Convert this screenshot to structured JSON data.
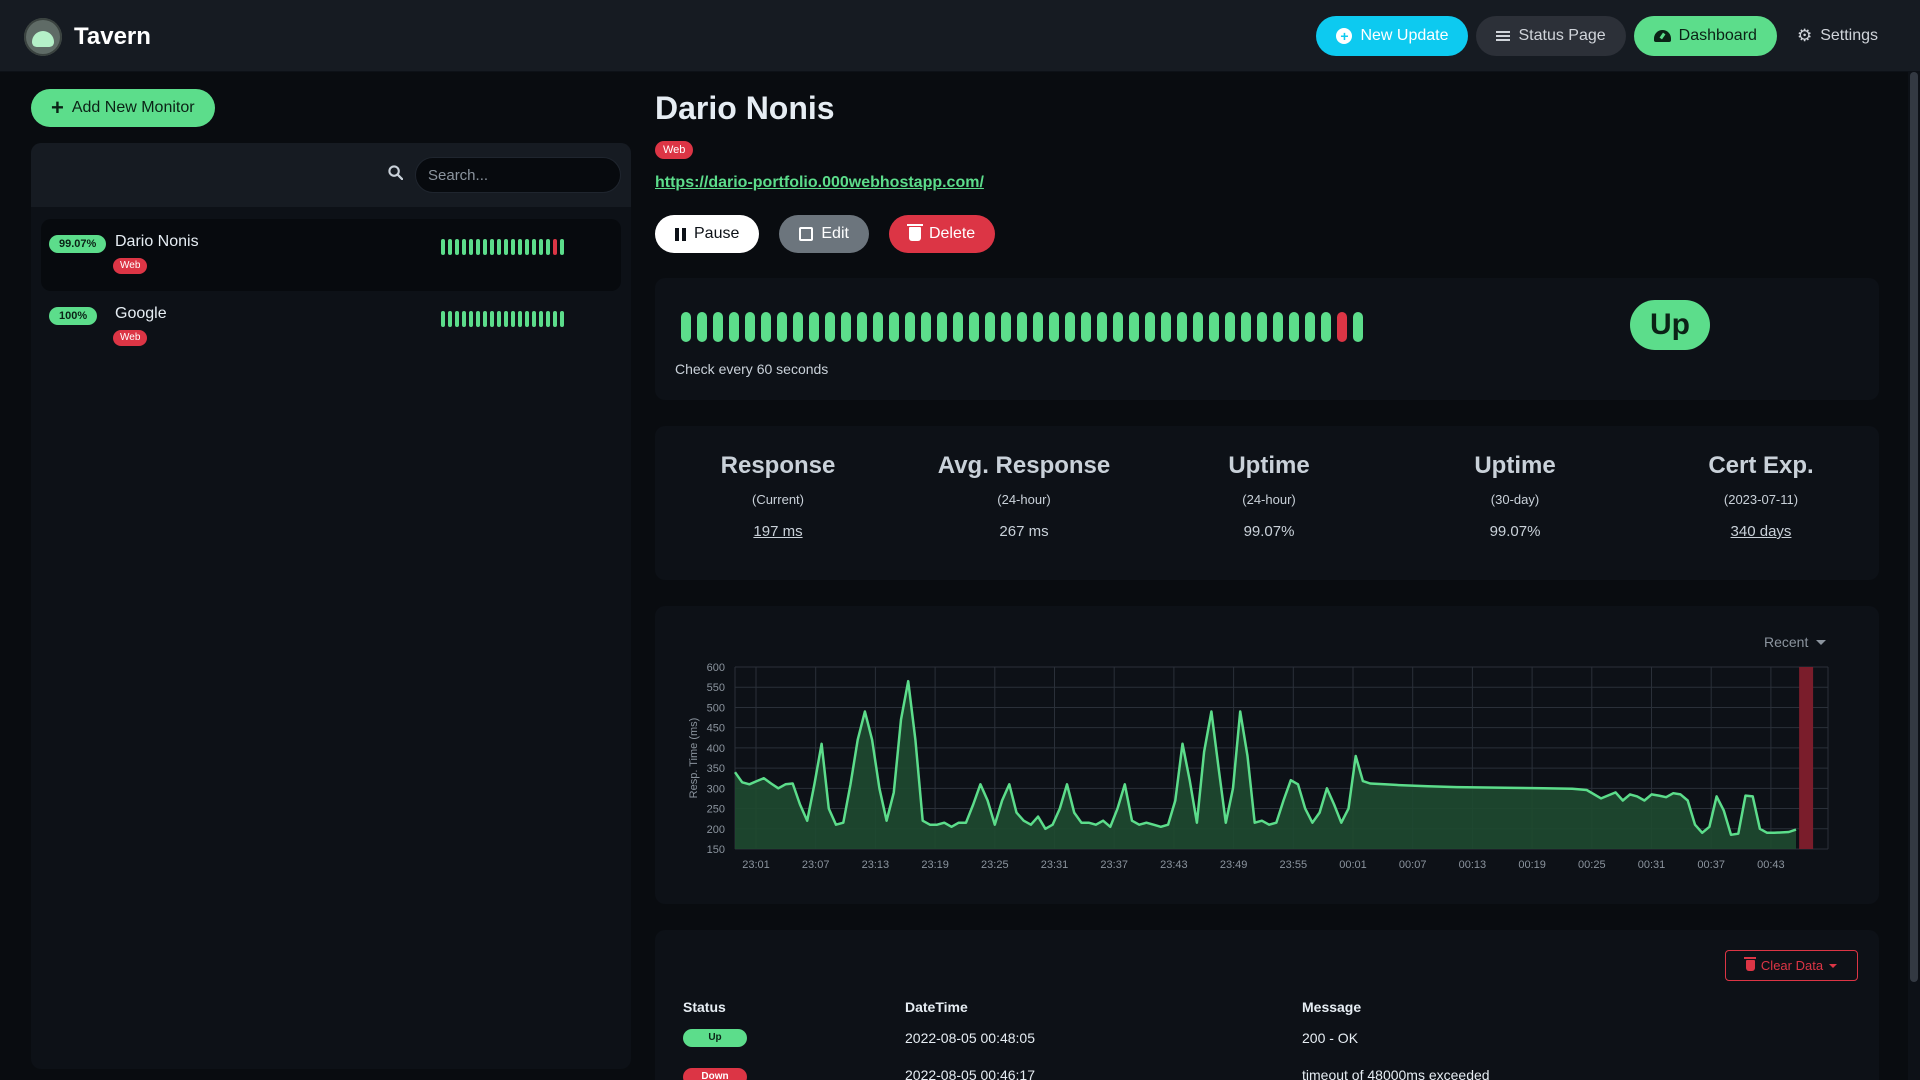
{
  "app": {
    "name": "Tavern"
  },
  "nav": {
    "new_update": "New Update",
    "status_page": "Status Page",
    "dashboard": "Dashboard",
    "settings": "Settings"
  },
  "sidebar": {
    "add_label": "Add New Monitor",
    "search_placeholder": "Search...",
    "monitors": [
      {
        "uptime": "99.07%",
        "name": "Dario Nonis",
        "tag": "Web",
        "beats": [
          1,
          1,
          1,
          1,
          1,
          1,
          1,
          1,
          1,
          1,
          1,
          1,
          1,
          1,
          1,
          1,
          0,
          1
        ]
      },
      {
        "uptime": "100%",
        "name": "Google",
        "tag": "Web",
        "beats": [
          1,
          1,
          1,
          1,
          1,
          1,
          1,
          1,
          1,
          1,
          1,
          1,
          1,
          1,
          1,
          1,
          1,
          1
        ]
      }
    ]
  },
  "detail": {
    "title": "Dario Nonis",
    "tag": "Web",
    "url": "https://dario-portfolio.000webhostapp.com/",
    "pause": "Pause",
    "edit": "Edit",
    "delete": "Delete",
    "check_every": "Check every 60 seconds",
    "status": "Up",
    "beats": [
      1,
      1,
      1,
      1,
      1,
      1,
      1,
      1,
      1,
      1,
      1,
      1,
      1,
      1,
      1,
      1,
      1,
      1,
      1,
      1,
      1,
      1,
      1,
      1,
      1,
      1,
      1,
      1,
      1,
      1,
      1,
      1,
      1,
      1,
      1,
      1,
      1,
      1,
      1,
      1,
      1,
      0,
      1
    ]
  },
  "stats": [
    {
      "heading": "Response",
      "sub": "(Current)",
      "value": "197 ms"
    },
    {
      "heading": "Avg. Response",
      "sub": "(24-hour)",
      "value": "267 ms"
    },
    {
      "heading": "Uptime",
      "sub": "(24-hour)",
      "value": "99.07%"
    },
    {
      "heading": "Uptime",
      "sub": "(30-day)",
      "value": "99.07%"
    },
    {
      "heading": "Cert Exp.",
      "sub": "(2023-07-11)",
      "value": "340 days"
    }
  ],
  "chart": {
    "range_label": "Recent",
    "colors": {
      "line": "#5cdd8b",
      "fill": "#1e4a30",
      "grid": "#2a3039",
      "down": "#7a1d2b",
      "tick": "#8b949e"
    }
  },
  "chart_data": {
    "type": "line",
    "title": "",
    "xlabel": "",
    "ylabel": "Resp. Time (ms)",
    "ylim": [
      150,
      600
    ],
    "yticks": [
      150,
      200,
      250,
      300,
      350,
      400,
      450,
      500,
      550,
      600
    ],
    "xticks": [
      "23:01",
      "23:07",
      "23:13",
      "23:19",
      "23:25",
      "23:31",
      "23:37",
      "23:43",
      "23:49",
      "23:55",
      "00:01",
      "00:07",
      "00:13",
      "00:19",
      "00:25",
      "00:31",
      "00:37",
      "00:43"
    ],
    "series": [
      {
        "values": [
          [
            0,
            340
          ],
          [
            0.5,
            315
          ],
          [
            1,
            310
          ],
          [
            1.5,
            318
          ],
          [
            2,
            325
          ],
          [
            2.5,
            312
          ],
          [
            3,
            300
          ],
          [
            3.5,
            310
          ],
          [
            4,
            312
          ],
          [
            4.5,
            260
          ],
          [
            5,
            220
          ],
          [
            5.5,
            310
          ],
          [
            6,
            410
          ],
          [
            6.5,
            250
          ],
          [
            7,
            210
          ],
          [
            7.5,
            215
          ],
          [
            8,
            310
          ],
          [
            8.5,
            420
          ],
          [
            9,
            490
          ],
          [
            9.5,
            420
          ],
          [
            10,
            300
          ],
          [
            10.5,
            220
          ],
          [
            11,
            290
          ],
          [
            11.5,
            470
          ],
          [
            12,
            565
          ],
          [
            12.5,
            420
          ],
          [
            13,
            220
          ],
          [
            13.5,
            210
          ],
          [
            14,
            210
          ],
          [
            14.5,
            215
          ],
          [
            15,
            205
          ],
          [
            15.5,
            215
          ],
          [
            16,
            215
          ],
          [
            16.5,
            260
          ],
          [
            17,
            310
          ],
          [
            17.5,
            270
          ],
          [
            18,
            210
          ],
          [
            18.5,
            270
          ],
          [
            19,
            310
          ],
          [
            19.5,
            240
          ],
          [
            20,
            220
          ],
          [
            20.5,
            210
          ],
          [
            21,
            230
          ],
          [
            21.5,
            200
          ],
          [
            22,
            210
          ],
          [
            22.5,
            250
          ],
          [
            23,
            310
          ],
          [
            23.5,
            240
          ],
          [
            24,
            215
          ],
          [
            24.5,
            215
          ],
          [
            25,
            210
          ],
          [
            25.5,
            220
          ],
          [
            26,
            205
          ],
          [
            26.5,
            250
          ],
          [
            27,
            310
          ],
          [
            27.5,
            220
          ],
          [
            28,
            210
          ],
          [
            28.5,
            215
          ],
          [
            29,
            210
          ],
          [
            29.5,
            205
          ],
          [
            30,
            210
          ],
          [
            30.5,
            270
          ],
          [
            31,
            410
          ],
          [
            31.5,
            320
          ],
          [
            32,
            215
          ],
          [
            32.5,
            390
          ],
          [
            33,
            490
          ],
          [
            33.5,
            350
          ],
          [
            34,
            215
          ],
          [
            34.5,
            300
          ],
          [
            35,
            490
          ],
          [
            35.5,
            380
          ],
          [
            36,
            215
          ],
          [
            36.5,
            220
          ],
          [
            37,
            210
          ],
          [
            37.5,
            215
          ],
          [
            38,
            270
          ],
          [
            38.5,
            320
          ],
          [
            39,
            310
          ],
          [
            39.5,
            250
          ],
          [
            40,
            215
          ],
          [
            40.5,
            240
          ],
          [
            41,
            300
          ],
          [
            41.5,
            260
          ],
          [
            42,
            215
          ],
          [
            42.5,
            250
          ],
          [
            43,
            380
          ],
          [
            43.5,
            318
          ],
          [
            44,
            312
          ],
          [
            45,
            310
          ],
          [
            46,
            308
          ],
          [
            48,
            305
          ],
          [
            50,
            303
          ],
          [
            52,
            302
          ],
          [
            54,
            301
          ],
          [
            56,
            300
          ],
          [
            58,
            299
          ],
          [
            59,
            296
          ],
          [
            60,
            275
          ],
          [
            61,
            290
          ],
          [
            61.5,
            270
          ],
          [
            62,
            285
          ],
          [
            62.5,
            280
          ],
          [
            63,
            270
          ],
          [
            63.5,
            285
          ],
          [
            64,
            282
          ],
          [
            64.5,
            278
          ],
          [
            65,
            288
          ],
          [
            65.5,
            285
          ],
          [
            66,
            270
          ],
          [
            66.5,
            210
          ],
          [
            67,
            190
          ],
          [
            67.5,
            205
          ],
          [
            68,
            280
          ],
          [
            68.5,
            245
          ],
          [
            69,
            185
          ],
          [
            69.5,
            188
          ],
          [
            70,
            282
          ],
          [
            70.5,
            280
          ],
          [
            71,
            200
          ],
          [
            71.5,
            190
          ],
          [
            72,
            190
          ],
          [
            73,
            192
          ],
          [
            73.5,
            198
          ]
        ]
      }
    ],
    "x_domain": [
      0,
      73.5
    ],
    "down_marker": {
      "position": 74.2
    }
  },
  "events": {
    "clear_label": "Clear Data",
    "columns": [
      "Status",
      "DateTime",
      "Message"
    ],
    "rows": [
      {
        "status": "Up",
        "datetime": "2022-08-05 00:48:05",
        "message": "200 - OK"
      },
      {
        "status": "Down",
        "datetime": "2022-08-05 00:46:17",
        "message": "timeout of 48000ms exceeded"
      }
    ]
  }
}
